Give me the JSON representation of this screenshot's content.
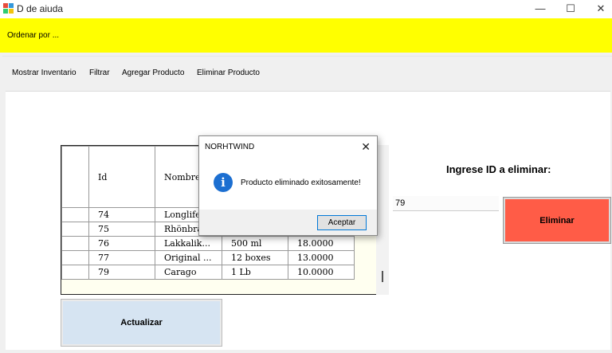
{
  "window": {
    "title": "D de aiuda"
  },
  "toolbar": {
    "order_label": "Ordenar por ..."
  },
  "menu": [
    "Mostrar Inventario",
    "Filtrar",
    "Agregar Producto",
    "Eliminar Producto"
  ],
  "grid": {
    "headers": [
      "Id",
      "Nombre",
      "",
      ""
    ],
    "rows": [
      [
        "74",
        "Longlife",
        "",
        ""
      ],
      [
        "75",
        "Rhönbrä",
        "",
        ""
      ],
      [
        "76",
        "Lakkalik...",
        "500 ml",
        "18.0000"
      ],
      [
        "77",
        "Original ...",
        "12 boxes",
        "13.0000"
      ],
      [
        "79",
        "Carago",
        "1 Lb",
        "10.0000"
      ]
    ]
  },
  "delete_panel": {
    "prompt": "Ingrese ID a eliminar:",
    "id_value": "79",
    "delete_label": "Eliminar"
  },
  "refresh_label": "Actualizar",
  "dialog": {
    "title": "NORHTWIND",
    "message": "Producto eliminado exitosamente!",
    "ok_label": "Aceptar"
  }
}
